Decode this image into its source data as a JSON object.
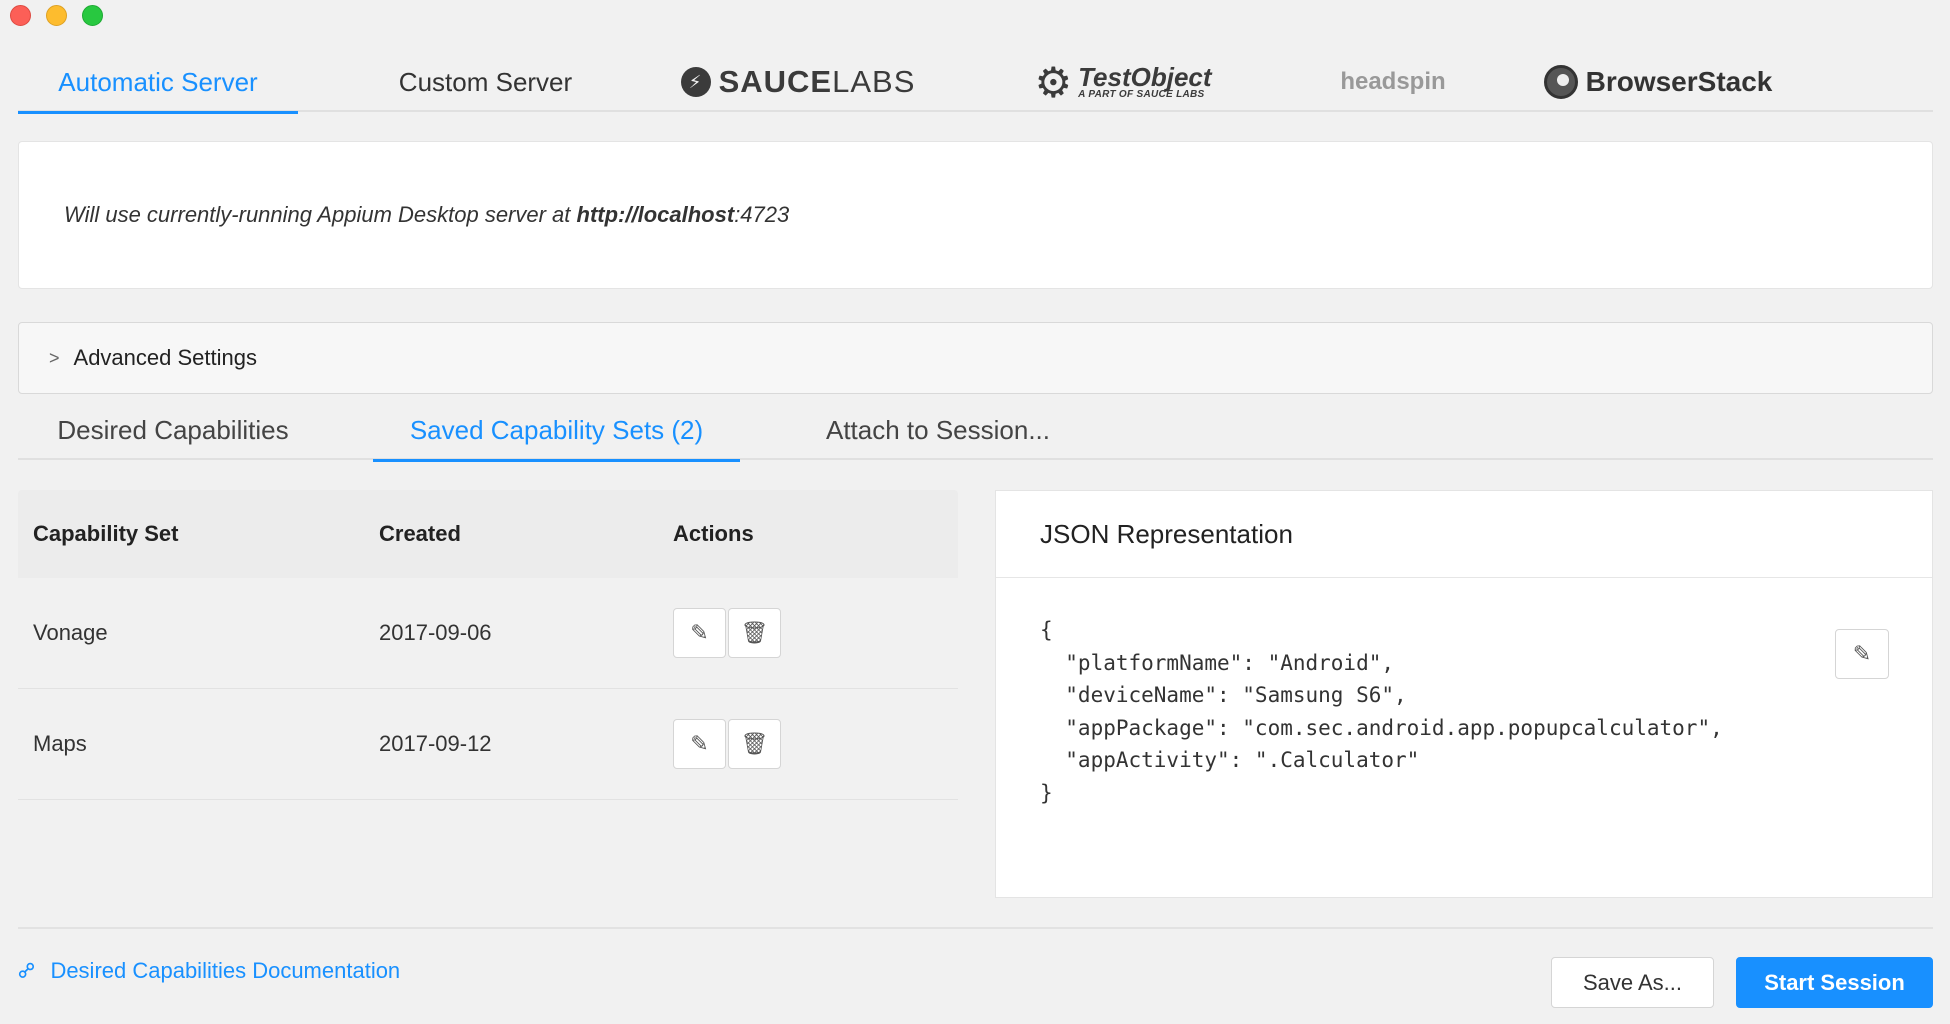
{
  "window": {
    "controls": [
      "close",
      "minimize",
      "maximize"
    ]
  },
  "server_tabs": [
    {
      "label": "Automatic Server",
      "active": true
    },
    {
      "label": "Custom Server",
      "active": false
    },
    {
      "label": "SAUCE",
      "label2": "LABS",
      "logo": "saucelabs-logo",
      "active": false
    },
    {
      "label": "TestObject",
      "sublabel": "A PART OF SAUCE LABS",
      "logo": "testobject-logo",
      "active": false
    },
    {
      "label": "headspin",
      "logo": "headspin-logo",
      "active": false
    },
    {
      "label": "BrowserStack",
      "logo": "browserstack-logo",
      "active": false
    }
  ],
  "info": {
    "prefix": "Will use currently-running Appium Desktop server at ",
    "url_bold": "http://localhost",
    "url_rest": ":4723"
  },
  "advanced": {
    "label": "Advanced Settings",
    "icon": "chevron-right-icon"
  },
  "cap_tabs": [
    {
      "label": "Desired Capabilities",
      "active": false
    },
    {
      "label": "Saved Capability Sets (2)",
      "active": true
    },
    {
      "label": "Attach to Session...",
      "active": false
    }
  ],
  "table": {
    "headers": [
      "Capability Set",
      "Created",
      "Actions"
    ],
    "rows": [
      {
        "name": "Vonage",
        "created": "2017-09-06"
      },
      {
        "name": "Maps",
        "created": "2017-09-12"
      }
    ],
    "action_icons": [
      "edit-icon",
      "trash-icon"
    ]
  },
  "json_panel": {
    "title": "JSON Representation",
    "content": "{\n  \"platformName\": \"Android\",\n  \"deviceName\": \"Samsung S6\",\n  \"appPackage\": \"com.sec.android.app.popupcalculator\",\n  \"appActivity\": \".Calculator\"\n}"
  },
  "footer": {
    "doc_link": "Desired Capabilities Documentation",
    "save_as": "Save As...",
    "start_session": "Start Session"
  },
  "colors": {
    "accent": "#1890ff",
    "background": "#f1f1f1"
  }
}
